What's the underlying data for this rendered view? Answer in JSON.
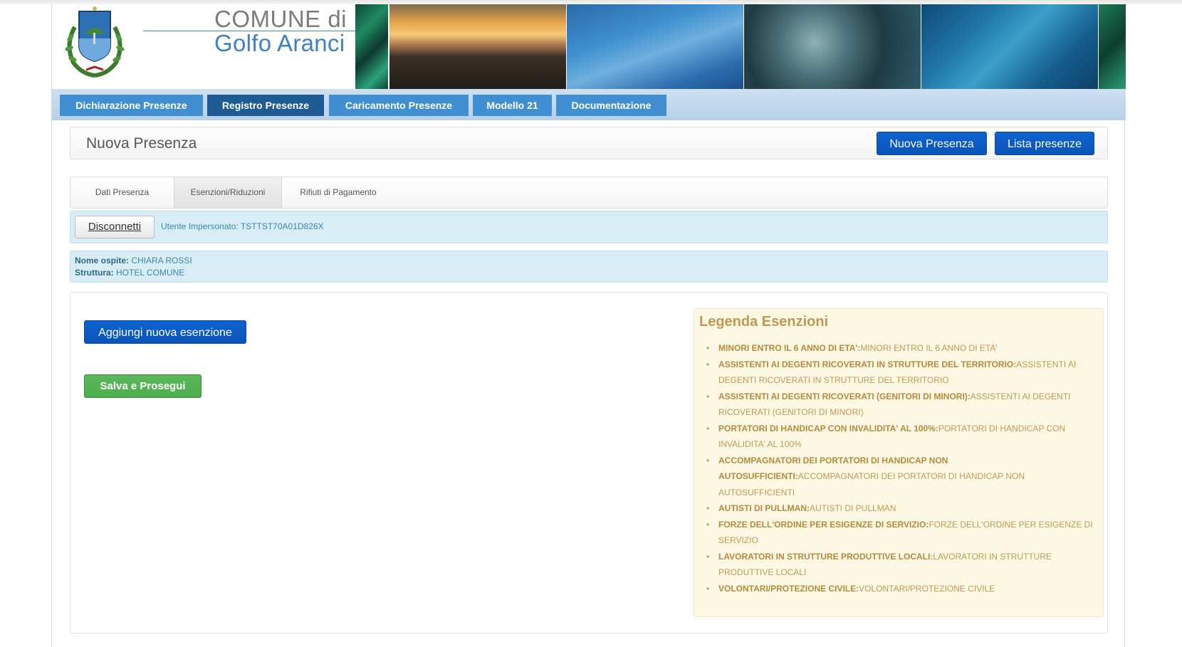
{
  "header": {
    "title_line1": "COMUNE di",
    "title_line2": "Golfo Aranci"
  },
  "nav": {
    "tabs": [
      {
        "label": "Dichiarazione Presenze",
        "active": false
      },
      {
        "label": "Registro Presenze",
        "active": true
      },
      {
        "label": "Caricamento Presenze",
        "active": false
      },
      {
        "label": "Modello 21",
        "active": false
      },
      {
        "label": "Documentazione",
        "active": false
      }
    ]
  },
  "page": {
    "title": "Nuova Presenza",
    "new_button": "Nuova Presenza",
    "list_button": "Lista presenze"
  },
  "subtabs": [
    {
      "label": "Dati Presenza",
      "active": false
    },
    {
      "label": "Esenzioni/Riduzioni",
      "active": true
    },
    {
      "label": "Rifiuti di Pagamento",
      "active": false
    }
  ],
  "impersonation": {
    "disconnect_label": "Disconnetti",
    "text": "Utente Impersonato: TSTTST70A01D826X"
  },
  "guest": {
    "name_label": "Nome ospite:",
    "name_value": "CHIARA ROSSI",
    "structure_label": "Struttura:",
    "structure_value": "HOTEL COMUNE"
  },
  "actions": {
    "add_exemption": "Aggiungi nuova esenzione",
    "save_continue": "Salva e Prosegui"
  },
  "legend": {
    "title": "Legenda Esenzioni",
    "items": [
      {
        "code": "MINORI ENTRO IL 6 ANNO DI ETA':",
        "desc": "MINORI ENTRO IL 6 ANNO DI ETA'"
      },
      {
        "code": "ASSISTENTI AI DEGENTI RICOVERATI IN STRUTTURE DEL TERRITORIO:",
        "desc": "ASSISTENTI AI DEGENTI RICOVERATI IN STRUTTURE DEL TERRITORIO"
      },
      {
        "code": "ASSISTENTI AI DEGENTI RICOVERATI (GENITORI DI MINORI):",
        "desc": "ASSISTENTI AI DEGENTI RICOVERATI (GENITORI DI MINORI)"
      },
      {
        "code": "PORTATORI DI HANDICAP CON INVALIDITA' AL 100%:",
        "desc": "PORTATORI DI HANDICAP CON INVALIDITA' AL 100%"
      },
      {
        "code": "ACCOMPAGNATORI DEI PORTATORI DI HANDICAP NON AUTOSUFFICIENTI:",
        "desc": "ACCOMPAGNATORI DEI PORTATORI DI HANDICAP NON AUTOSUFFICIENTI"
      },
      {
        "code": "AUTISTI DI PULLMAN:",
        "desc": "AUTISTI DI PULLMAN"
      },
      {
        "code": "FORZE DELL'ORDINE PER ESIGENZE DI SERVIZIO:",
        "desc": "FORZE DELL'ORDINE PER ESIGENZE DI SERVIZIO"
      },
      {
        "code": "LAVORATORI IN STRUTTURE PRODUTTIVE LOCALI:",
        "desc": "LAVORATORI IN STRUTTURE PRODUTTIVE LOCALI"
      },
      {
        "code": "VOLONTARI/PROTEZIONE CIVILE:",
        "desc": "VOLONTARI/PROTEZIONE CIVILE"
      }
    ]
  },
  "colors": {
    "primary_blue": "#0e63cf",
    "nav_tab": "#3f8fd2",
    "nav_tab_active": "#1e5b94",
    "success_green": "#5cb85c",
    "legend_text": "#c09853",
    "info_text": "#3a87ad"
  },
  "icons": {
    "crest": "coat-of-arms-icon"
  }
}
